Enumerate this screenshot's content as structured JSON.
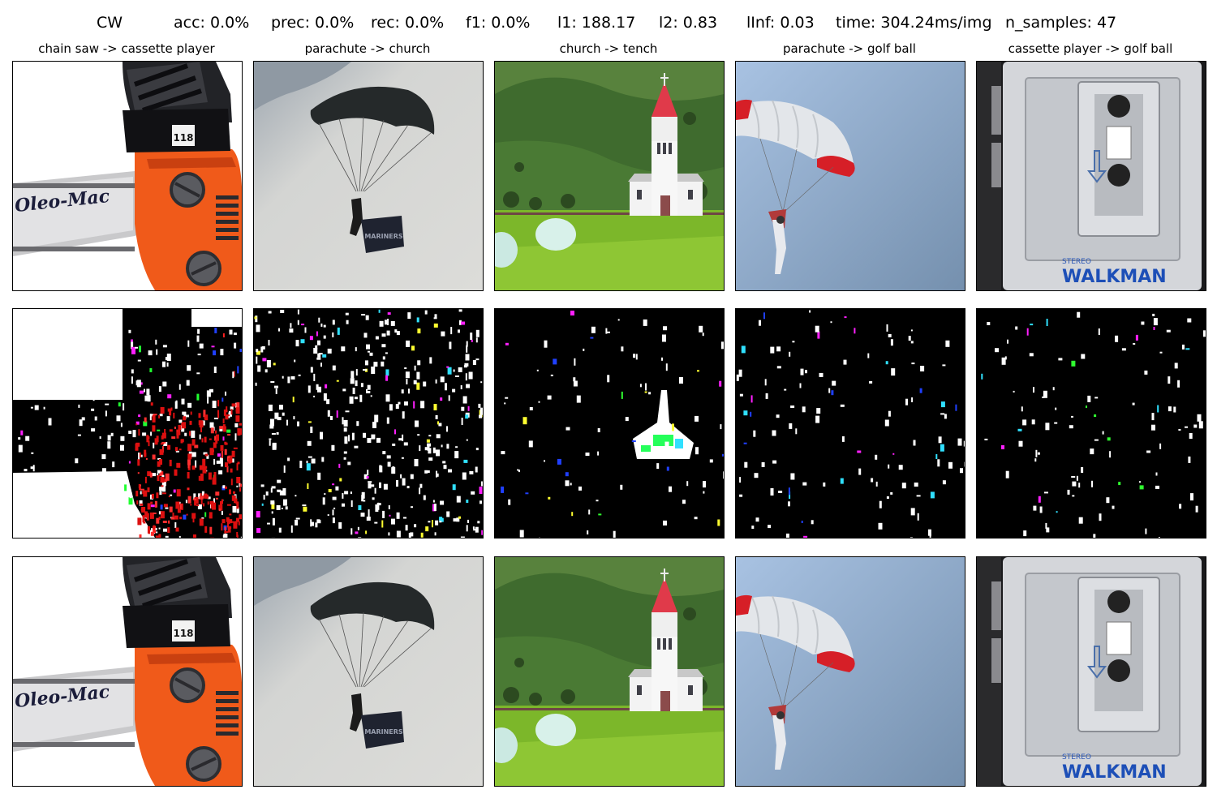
{
  "metrics": {
    "method": "CW",
    "acc": "acc: 0.0%",
    "prec": "prec: 0.0%",
    "rec": "rec: 0.0%",
    "f1": "f1: 0.0%",
    "l1": "l1: 188.17",
    "l2": "l2: 0.83",
    "linf": "lInf: 0.03",
    "time": "time: 304.24ms/img",
    "n_samples": "n_samples: 47"
  },
  "columns": [
    {
      "title": "chain saw -> cassette player",
      "subject": "chainsaw",
      "brand_text": "Oleo-Mac",
      "badge_text": "118"
    },
    {
      "title": "parachute -> church",
      "subject": "parachute-gray",
      "banner_text": "MARINERS"
    },
    {
      "title": "church -> tench",
      "subject": "church"
    },
    {
      "title": "parachute -> golf ball",
      "subject": "parachute-blue"
    },
    {
      "title": "cassette player -> golf ball",
      "subject": "walkman",
      "stereo_text": "STEREO",
      "brand_text": "WALKMAN"
    }
  ],
  "rows": [
    "original",
    "perturbation",
    "adversarial"
  ]
}
